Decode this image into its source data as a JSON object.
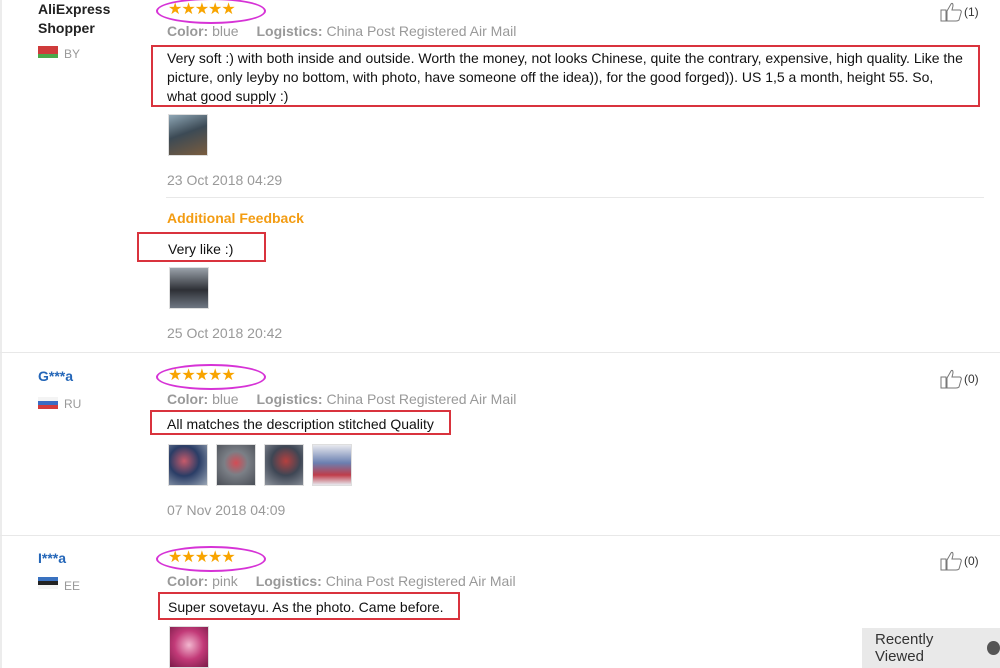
{
  "reviews": [
    {
      "buyer_name": "AliExpress Shopper",
      "country": "BY",
      "stars": "★★★★★",
      "likes": "(1)",
      "color_label": "Color:",
      "color_value": "blue",
      "logistics_label": "Logistics:",
      "logistics_value": "China Post Registered Air Mail",
      "text": "Very soft :) with both inside and outside. Worth the money, not looks Chinese, quite the contrary, expensive, high quality. Like the picture, only leyby no bottom, with photo, have someone off the idea)), for the good forged)). US 1,5 a month, height 55. So, what good supply :)",
      "date": "23 Oct 2018 04:29",
      "additional": {
        "title": "Additional Feedback",
        "text": "Very like :)",
        "date": "25 Oct 2018 20:42"
      }
    },
    {
      "buyer_name": "G***a",
      "country": "RU",
      "stars": "★★★★★",
      "likes": "(0)",
      "color_label": "Color:",
      "color_value": "blue",
      "logistics_label": "Logistics:",
      "logistics_value": "China Post Registered Air Mail",
      "text": "All matches the description stitched Quality",
      "date": "07 Nov 2018 04:09"
    },
    {
      "buyer_name": "I***a",
      "country": "EE",
      "stars": "★★★★★",
      "likes": "(0)",
      "color_label": "Color:",
      "color_value": "pink",
      "logistics_label": "Logistics:",
      "logistics_value": "China Post Registered Air Mail",
      "text": "Super sovetayu. As the photo. Came before."
    }
  ],
  "recently_viewed": "Recently Viewed",
  "colors": {
    "star": "#f8a400",
    "highlight_box": "#d9333d",
    "highlight_oval": "#d633d6",
    "link": "#2466b8",
    "additional": "#f39c12"
  }
}
